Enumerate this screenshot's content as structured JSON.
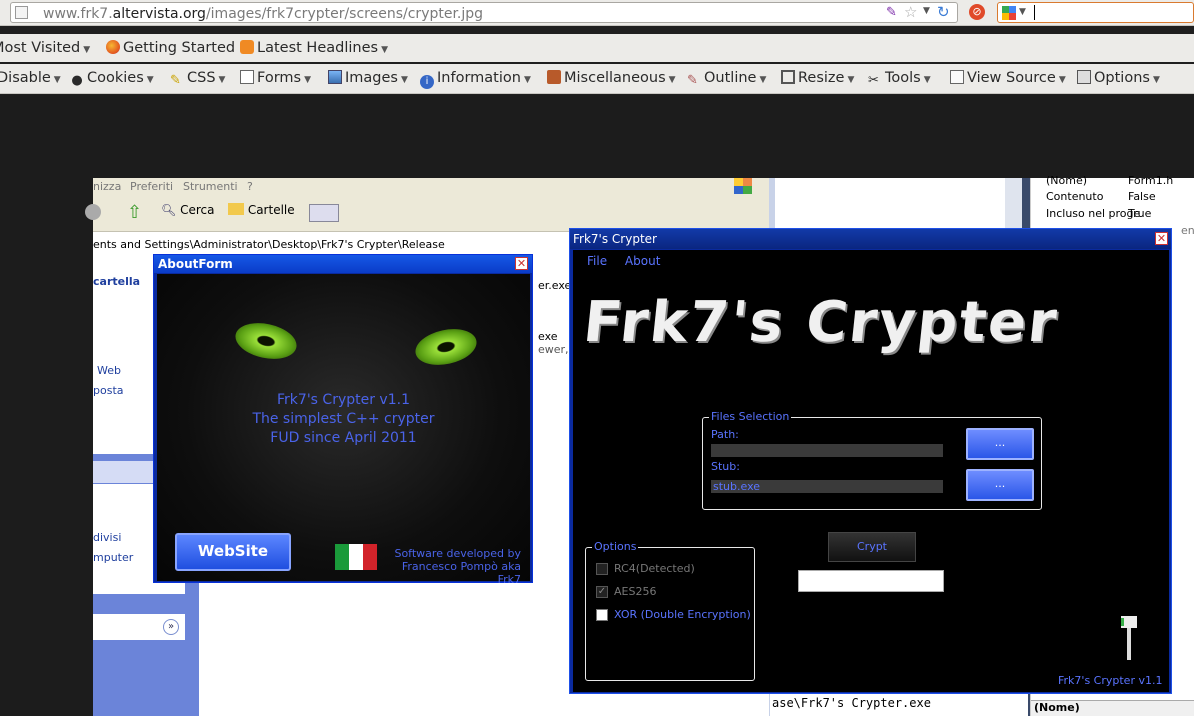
{
  "browser": {
    "url_gray_prefix": "www.frk7.",
    "url_domain": "altervista.org",
    "url_path": "/images/frk7crypter/screens/crypter.jpg",
    "search_value": ""
  },
  "bookmarks": {
    "items": [
      {
        "label": "Most Visited",
        "icon": "star-icon"
      },
      {
        "label": "Getting Started",
        "icon": "firefox-icon"
      },
      {
        "label": "Latest Headlines",
        "icon": "rss-icon"
      }
    ]
  },
  "devtoolbar": {
    "items": [
      {
        "label": "Disable"
      },
      {
        "label": "Cookies"
      },
      {
        "label": "CSS"
      },
      {
        "label": "Forms"
      },
      {
        "label": "Images"
      },
      {
        "label": "Information"
      },
      {
        "label": "Miscellaneous"
      },
      {
        "label": "Outline"
      },
      {
        "label": "Resize"
      },
      {
        "label": "Tools"
      },
      {
        "label": "View Source"
      },
      {
        "label": "Options"
      }
    ]
  },
  "explorer": {
    "menu": [
      "nizza",
      "Preferiti",
      "Strumenti",
      "?"
    ],
    "toolbar_search": "Cerca",
    "toolbar_folders": "Cartelle",
    "address": "ents and Settings\\Administrator\\Desktop\\Frk7's Crypter\\Release",
    "side_items": [
      "cartella",
      "Web",
      "posta",
      "divisi",
      "mputer"
    ],
    "file_snippets": [
      "er.exe",
      "exe",
      "ewer, de"
    ]
  },
  "properties": {
    "rows": [
      {
        "key": "(Nome)",
        "value": "Form1.h"
      },
      {
        "key": "Contenuto",
        "value": "False"
      },
      {
        "key": "Incluso nel proge",
        "value": "True"
      }
    ],
    "footer": "(Nome)",
    "snippet": "ents"
  },
  "about": {
    "title": "AboutForm",
    "line1": "Frk7's Crypter v1.1",
    "line2": "The simplest C++ crypter",
    "line3": "FUD since April 2011",
    "website_button": "WebSite",
    "dev_line1": "Software developed by",
    "dev_line2": "Francesco Pompò aka Frk7"
  },
  "crypter": {
    "title": "Frk7's Crypter",
    "menu_file": "File",
    "menu_about": "About",
    "logo": "Frk7's Crypter",
    "files_group": "Files Selection",
    "path_label": "Path:",
    "path_value": "",
    "stub_label": "Stub:",
    "stub_value": "stub.exe",
    "browse1": "...",
    "browse2": "...",
    "options_group": "Options",
    "opt_rc4": "RC4(Detected)",
    "opt_aes": "AES256",
    "opt_xor": "XOR (Double Encryption)",
    "crypt_button": "Crypt",
    "version": "Frk7's Crypter v1.1"
  },
  "bottom_path": "ase\\Frk7's Crypter.exe",
  "colors": {
    "accent_blue": "#5a74ff",
    "xp_title": "#0a3cc8"
  }
}
